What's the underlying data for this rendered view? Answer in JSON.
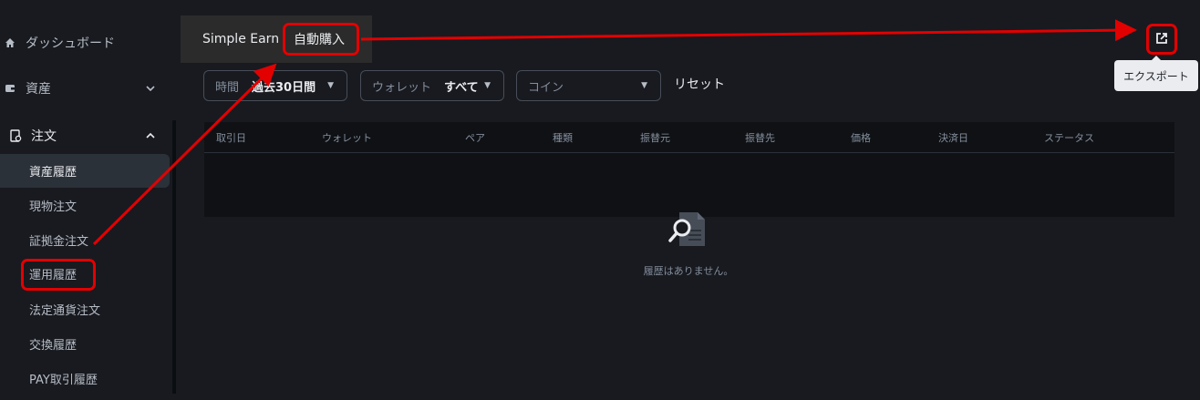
{
  "sidebar": {
    "top_items": [
      {
        "label": "ダッシュボード",
        "icon": "home-icon"
      },
      {
        "label": "資産",
        "icon": "wallet-icon"
      },
      {
        "label": "注文",
        "icon": "order-icon"
      }
    ],
    "sub_items": [
      {
        "label": "資産履歴"
      },
      {
        "label": "現物注文"
      },
      {
        "label": "証拠金注文"
      },
      {
        "label": "運用履歴"
      },
      {
        "label": "法定通貨注文"
      },
      {
        "label": "交換履歴"
      },
      {
        "label": "PAY取引履歴"
      }
    ]
  },
  "tabs": [
    {
      "label": "Simple Earn"
    },
    {
      "label": "自動購入"
    }
  ],
  "filters": {
    "time": {
      "label": "時間",
      "value": "過去30日間"
    },
    "wallet": {
      "label": "ウォレット",
      "value": "すべて"
    },
    "coin": {
      "placeholder": "コイン"
    },
    "reset_label": "リセット"
  },
  "table": {
    "columns": [
      "取引日",
      "ウォレット",
      "ペア",
      "種類",
      "振替元",
      "振替先",
      "価格",
      "決済日",
      "ステータス"
    ],
    "empty_text": "履歴はありません。"
  },
  "export": {
    "tooltip": "エクスポート",
    "icon": "external-link-icon"
  },
  "colors": {
    "background": "#181a20",
    "annotation": "#e30000",
    "active_item": "#2b3139"
  }
}
